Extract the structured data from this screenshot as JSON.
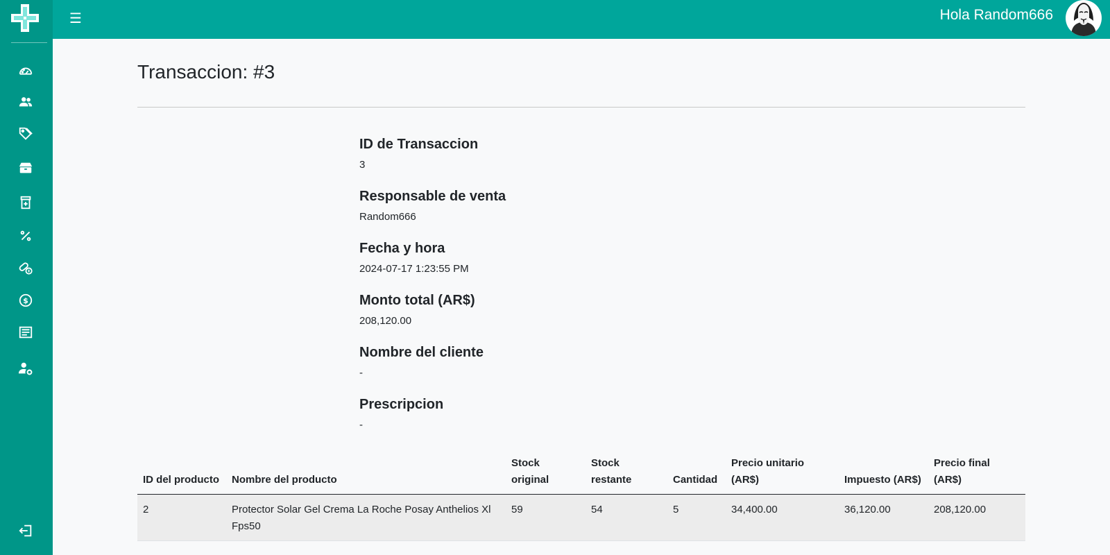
{
  "header": {
    "greeting": "Hola Random666"
  },
  "sidebar": {
    "icons": [
      "dashboard-icon",
      "users-icon",
      "tags-icon",
      "inventory-icon",
      "medicine-icon",
      "percent-icon",
      "pills-info-icon",
      "dollar-icon",
      "receipt-icon",
      "user-settings-icon",
      "logout-icon"
    ]
  },
  "page": {
    "title": "Transaccion: #3"
  },
  "details": {
    "id_label": "ID de Transaccion",
    "id_value": "3",
    "seller_label": "Responsable de venta",
    "seller_value": "Random666",
    "date_label": "Fecha y hora",
    "date_value": "2024-07-17 1:23:55 PM",
    "total_label": "Monto total (AR$)",
    "total_value": "208,120.00",
    "client_label": "Nombre del cliente",
    "client_value": "-",
    "prescription_label": "Prescripcion",
    "prescription_value": "-"
  },
  "table": {
    "headers": [
      "ID del producto",
      "Nombre del producto",
      "Stock original",
      "Stock restante",
      "Cantidad",
      "Precio unitario (AR$)",
      "Impuesto (AR$)",
      "Precio final (AR$)"
    ],
    "rows": [
      [
        "2",
        "Protector Solar Gel Crema La Roche Posay Anthelios Xl Fps50",
        "59",
        "54",
        "5",
        "34,400.00",
        "36,120.00",
        "208,120.00"
      ]
    ]
  },
  "colors": {
    "sidebar": "#009688",
    "topbar": "#00a69b",
    "background": "#f8f9fa"
  }
}
